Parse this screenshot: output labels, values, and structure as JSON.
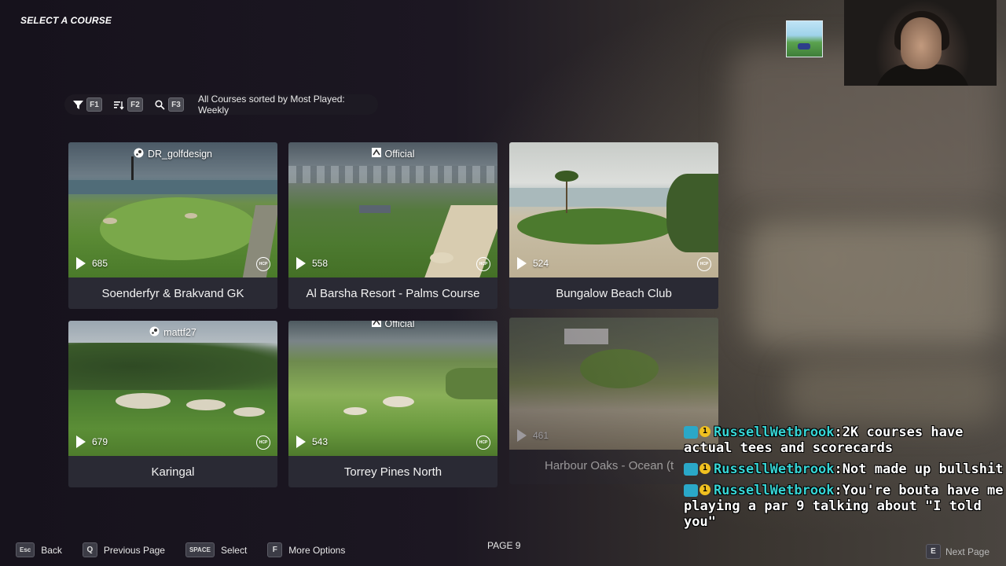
{
  "header": {
    "title": "SELECT A COURSE"
  },
  "filter_bar": {
    "filter_key": "F1",
    "sort_key": "F2",
    "search_key": "F3",
    "status_text": "All Courses sorted by Most Played: Weekly"
  },
  "courses": [
    {
      "name": "Soenderfyr & Brakvand GK",
      "author": "DR_golfdesign",
      "author_type": "steam",
      "plays": "685"
    },
    {
      "name": "Al Barsha Resort - Palms Course",
      "author": "Official",
      "author_type": "official",
      "plays": "558"
    },
    {
      "name": "Bungalow Beach Club",
      "author": "",
      "author_type": "none",
      "plays": "524"
    },
    {
      "name": "Karingal",
      "author": "mattf27",
      "author_type": "steam",
      "plays": "679"
    },
    {
      "name": "Torrey Pines North",
      "author": "Official",
      "author_type": "official",
      "plays": "543"
    },
    {
      "name": "Harbour Oaks - Ocean (t",
      "author": "",
      "author_type": "none",
      "plays": "461"
    }
  ],
  "hcp_label": "HCP",
  "footer": {
    "back_key": "Esc",
    "back_label": "Back",
    "prev_key": "Q",
    "prev_label": "Previous Page",
    "select_key": "SPACE",
    "select_label": "Select",
    "options_key": "F",
    "options_label": "More Options",
    "page_label": "PAGE 9",
    "next_key": "E",
    "next_label": "Next Page"
  },
  "chat": [
    {
      "user": "RussellWetbrook",
      "text": "2K courses have actual tees and scorecards"
    },
    {
      "user": "RussellWetbrook",
      "text": "Not made up bullshit"
    },
    {
      "user": "RussellWetbrook",
      "text": "You're bouta have me playing a par 9 talking about \"I told you\""
    }
  ],
  "colors": {
    "chat_user": "#37d4d4",
    "card_bg": "#2a2a34",
    "badge": "#2aa8c8"
  }
}
